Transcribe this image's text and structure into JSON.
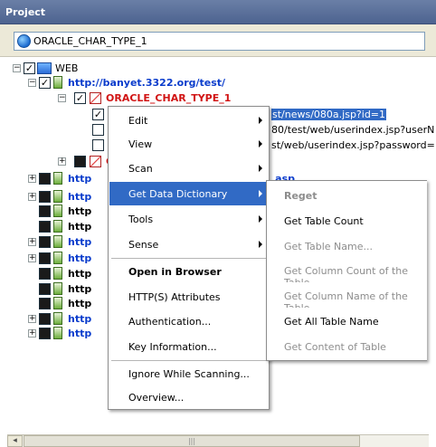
{
  "panel": {
    "title": "Project"
  },
  "url": {
    "value": "ORACLE_CHAR_TYPE_1",
    "icon": "globe-icon"
  },
  "tree": {
    "root_label": "WEB",
    "site_label": "http://banyet.3322.org/test/",
    "node_label": "ORACLE_CHAR_TYPE_1",
    "child_rows": [
      "st/news/080a.jsp?id=1",
      "80/test/web/userindex.jsp?userN",
      "st/web/userindex.jsp?password="
    ],
    "site_rows": [
      {
        "label": "http",
        "trail": ".asp"
      },
      {
        "label": "http",
        "trail": ""
      },
      {
        "label": "http",
        "trail": ""
      },
      {
        "label": "http",
        "trail": ""
      },
      {
        "label": "http",
        "trail": ""
      },
      {
        "label": "http",
        "trail": ""
      },
      {
        "label": "http",
        "trail": ""
      },
      {
        "label": "http",
        "trail": ""
      },
      {
        "label": "http",
        "trail": ""
      },
      {
        "label": "http",
        "trail": ""
      },
      {
        "label": "http",
        "trail": ""
      }
    ]
  },
  "context_menu": {
    "items": [
      {
        "label": "Edit",
        "submenu": true
      },
      {
        "label": "View",
        "submenu": true
      },
      {
        "label": "Scan",
        "submenu": true
      },
      {
        "label": "Get Data Dictionary",
        "submenu": true,
        "selected": true
      },
      {
        "label": "Tools",
        "submenu": true
      },
      {
        "label": "Sense",
        "submenu": true
      },
      {
        "label": "Open in Browser",
        "bold": true
      },
      {
        "label": "HTTP(S) Attributes"
      },
      {
        "label": "Authentication..."
      },
      {
        "label": "Key Information..."
      },
      {
        "label": "Ignore While Scanning..."
      },
      {
        "label": "Overview..."
      }
    ]
  },
  "submenu": {
    "items": [
      {
        "label": "Reget",
        "disabled": true,
        "bold": true
      },
      {
        "label": "Get Table Count",
        "disabled": false
      },
      {
        "label": "Get Table Name...",
        "disabled": true
      },
      {
        "label": "Get Column Count of the Table",
        "disabled": true
      },
      {
        "label": "Get Column Name of the Table",
        "disabled": true
      },
      {
        "label": "Get All Table Name",
        "disabled": false
      },
      {
        "label": "Get Content of Table",
        "disabled": true
      }
    ]
  },
  "scrollbar": {
    "left_arrow": "◂",
    "grip": "|||"
  },
  "colors": {
    "title_bar": "#4d6390",
    "link": "#0a3ccc",
    "node_red": "#d11414",
    "selection": "#316ac5"
  }
}
